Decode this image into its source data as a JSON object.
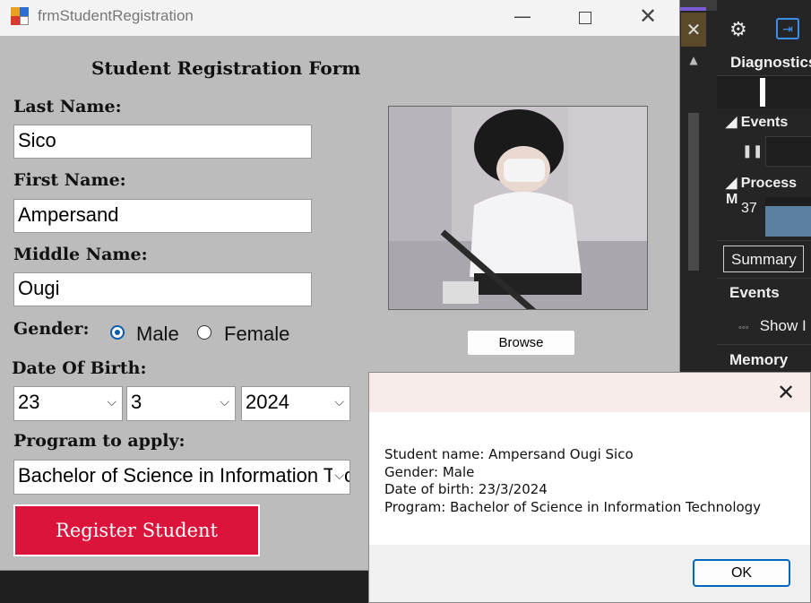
{
  "ide": {
    "panel_title": "Diagnostics",
    "events_header": "Events",
    "process_header": "Process M",
    "process_value": "37",
    "summary_tab": "Summary",
    "events_row": "Events",
    "show_link": "Show I",
    "memory_row": "Memory Us",
    "close_glyph": "✕"
  },
  "window": {
    "title": "frmStudentRegistration"
  },
  "form": {
    "heading": "Student Registration Form",
    "last_name_label": "Last Name:",
    "last_name_value": "Sico",
    "first_name_label": "First Name:",
    "first_name_value": "Ampersand",
    "middle_name_label": "Middle Name:",
    "middle_name_value": "Ougi",
    "gender_label": "Gender:",
    "gender_male": "Male",
    "gender_female": "Female",
    "gender_selected": "Male",
    "dob_label": "Date Of Birth:",
    "dob_day": "23",
    "dob_month": "3",
    "dob_year": "2024",
    "program_label": "Program to apply:",
    "program_value": "Bachelor of Science in Information Technology",
    "register_label": "Register Student",
    "browse_label": "Browse"
  },
  "message": {
    "line1": "Student name: Ampersand Ougi Sico",
    "line2": "Gender: Male",
    "line3": "Date of birth: 23/3/2024",
    "line4": "Program: Bachelor of Science in Information Technology",
    "ok_label": "OK"
  },
  "colors": {
    "register_button": "#dc143c",
    "form_background": "#bcbcbc",
    "accent_blue": "#0067c0"
  }
}
